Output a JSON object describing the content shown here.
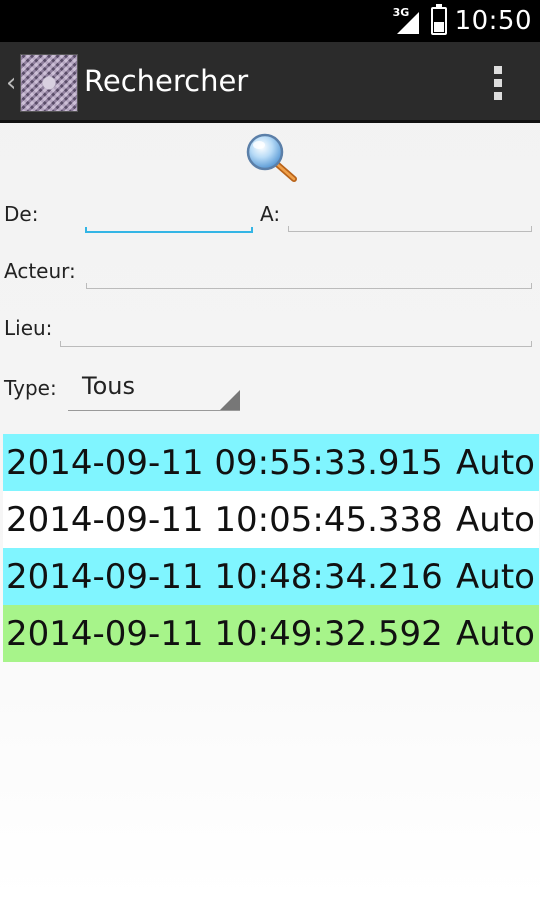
{
  "status_bar": {
    "network": "3G",
    "time": "10:50",
    "battery_level": 0.45
  },
  "action_bar": {
    "title": "Rechercher",
    "up_icon": "chevron-left-icon",
    "app_icon": "app-logo-icon",
    "overflow_icon": "overflow-menu-icon"
  },
  "search": {
    "icon": "magnifier-icon"
  },
  "form": {
    "de_label": "De:",
    "de_value": "",
    "a_label": "A:",
    "a_value": "",
    "acteur_label": "Acteur:",
    "acteur_value": "",
    "lieu_label": "Lieu:",
    "lieu_value": "",
    "type_label": "Type:",
    "type_value": "Tous"
  },
  "results": [
    {
      "timestamp": "2014-09-11 09:55:33.915",
      "type": "Auto",
      "color": "#80f5ff"
    },
    {
      "timestamp": "2014-09-11 10:05:45.338",
      "type": "Auto",
      "color": "#ffffff"
    },
    {
      "timestamp": "2014-09-11 10:48:34.216",
      "type": "Auto",
      "color": "#80f5ff"
    },
    {
      "timestamp": "2014-09-11 10:49:32.592",
      "type": "Auto",
      "color": "#a7f48a"
    }
  ],
  "colors": {
    "accent": "#33b5e5",
    "action_bar": "#2b2b2b"
  }
}
